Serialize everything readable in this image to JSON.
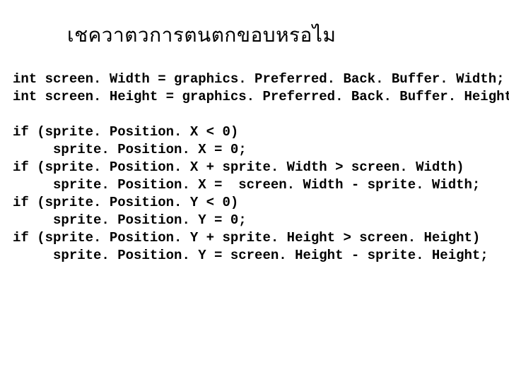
{
  "title": "เชควาตวการตนตกขอบหรอไม",
  "line1": "int screen. Width = graphics. Preferred. Back. Buffer. Width;",
  "line2": "int screen. Height = graphics. Preferred. Back. Buffer. Height;",
  "blank1": "",
  "line3": "if (sprite. Position. X < 0)",
  "line4": "     sprite. Position. X = 0;",
  "line5": "if (sprite. Position. X + sprite. Width > screen. Width)",
  "line6": "     sprite. Position. X =  screen. Width - sprite. Width;",
  "line7": "if (sprite. Position. Y < 0)",
  "line8": "     sprite. Position. Y = 0;",
  "line9": "if (sprite. Position. Y + sprite. Height > screen. Height)",
  "line10": "     sprite. Position. Y = screen. Height - sprite. Height;"
}
